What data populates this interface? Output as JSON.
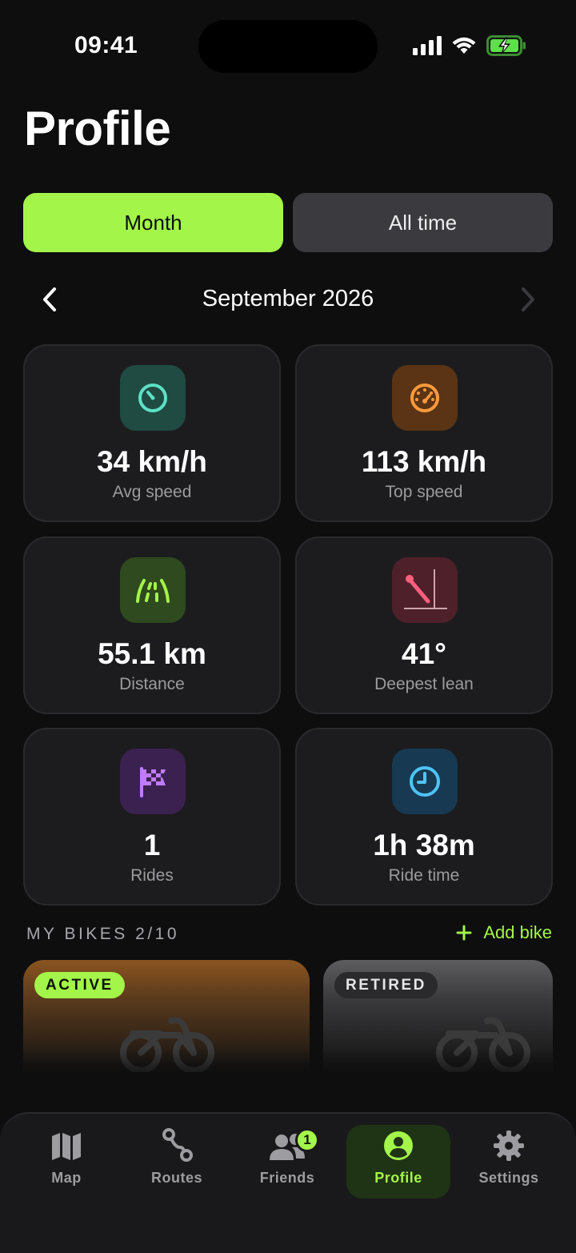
{
  "status_bar": {
    "time": "09:41"
  },
  "header": {
    "title": "Profile"
  },
  "segments": {
    "month": "Month",
    "all_time": "All time"
  },
  "period": {
    "label": "September 2026"
  },
  "stats": [
    {
      "value": "34 km/h",
      "label": "Avg speed",
      "icon": "speedometer-icon",
      "color": "#5ee0c4"
    },
    {
      "value": "113 km/h",
      "label": "Top speed",
      "icon": "gauge-icon",
      "color": "#ff9a3c"
    },
    {
      "value": "55.1 km",
      "label": "Distance",
      "icon": "road-icon",
      "color": "#a3f54a"
    },
    {
      "value": "41°",
      "label": "Deepest lean",
      "icon": "lean-angle-icon",
      "color": "#ff5f7e"
    },
    {
      "value": "1",
      "label": "Rides",
      "icon": "checkered-flag-icon",
      "color": "#b96bff"
    },
    {
      "value": "1h 38m",
      "label": "Ride time",
      "icon": "clock-icon",
      "color": "#4fc3f7"
    }
  ],
  "bikes": {
    "heading": "MY BIKES 2/10",
    "add_label": "Add bike",
    "items": [
      {
        "badge": "ACTIVE"
      },
      {
        "badge": "RETIRED"
      }
    ]
  },
  "tabbar": {
    "items": [
      {
        "label": "Map",
        "icon": "map-icon"
      },
      {
        "label": "Routes",
        "icon": "routes-icon"
      },
      {
        "label": "Friends",
        "icon": "friends-icon",
        "badge": "1"
      },
      {
        "label": "Profile",
        "icon": "profile-icon",
        "active": true
      },
      {
        "label": "Settings",
        "icon": "gear-icon"
      }
    ]
  },
  "colors": {
    "accent": "#a3f54a",
    "background": "#0e0e0f",
    "card": "#1c1c1e"
  }
}
